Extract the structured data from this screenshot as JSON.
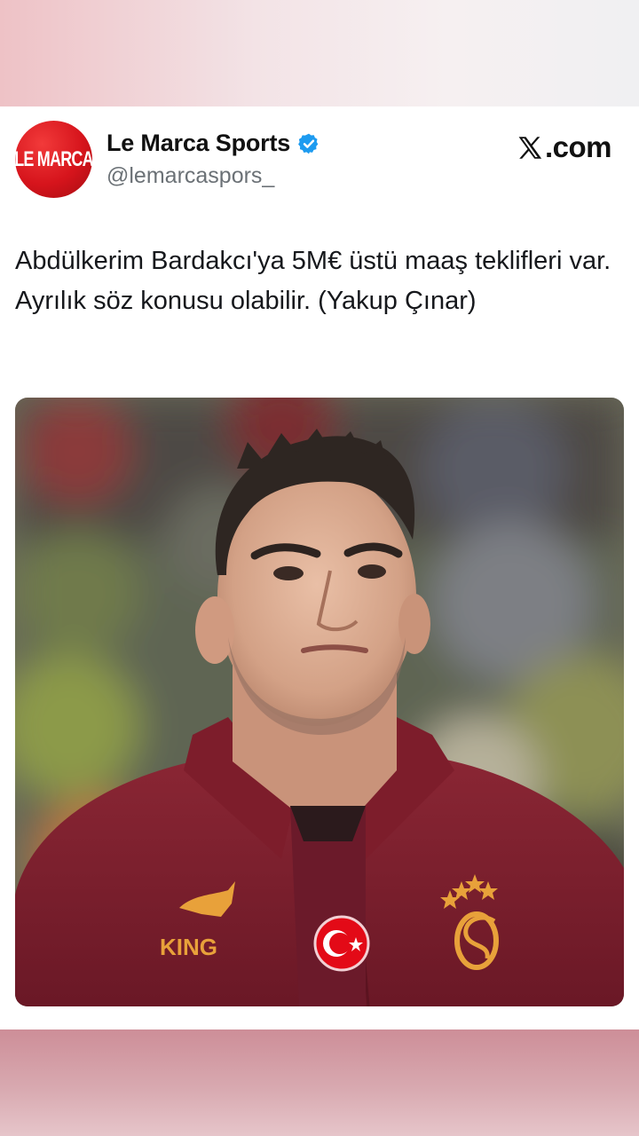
{
  "post": {
    "avatar": {
      "icon": "le-marca-logo",
      "text": "LE MARCA",
      "color": "#d6141c"
    },
    "display_name": "Le Marca Sports",
    "verified_icon": "verified-badge-icon",
    "verified_color": "#1d9bf0",
    "handle": "@lemarcaspors_",
    "source": {
      "icon": "x-logo-icon",
      "label": ".com"
    },
    "text": "Abdülkerim Bardakcı'ya 5M€ üstü maaş teklifleri var. Ayrılık söz konusu olabilir. (Yakup Çınar)",
    "photo": {
      "icon": "player-photo",
      "sponsor_text": "KING",
      "jersey_color": "#7e1f2c",
      "accent_color": "#e8a13a"
    }
  }
}
